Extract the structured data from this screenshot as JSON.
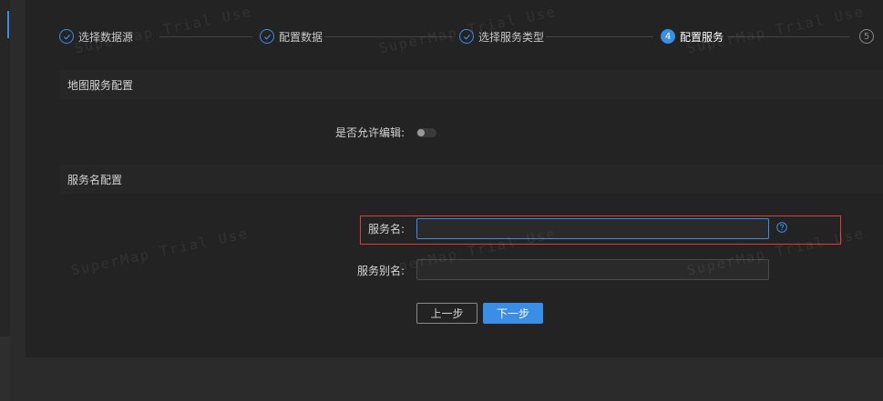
{
  "watermark_text": "SuperMap Trial Use",
  "steps": [
    {
      "index": "1",
      "label": "选择数据源",
      "state": "done"
    },
    {
      "index": "2",
      "label": "配置数据",
      "state": "done"
    },
    {
      "index": "3",
      "label": "选择服务类型",
      "state": "done"
    },
    {
      "index": "4",
      "label": "配置服务",
      "state": "active"
    },
    {
      "index": "5",
      "label": "",
      "state": "pending"
    }
  ],
  "map_service_section": {
    "title": "地图服务配置",
    "allow_edit_label": "是否允许编辑:",
    "allow_edit_value": false
  },
  "service_name_section": {
    "title": "服务名配置",
    "service_name_label": "服务名:",
    "service_name_value": "",
    "service_alias_label": "服务别名:",
    "service_alias_value": ""
  },
  "buttons": {
    "prev_label": "上一步",
    "next_label": "下一步"
  },
  "colors": {
    "accent": "#3a8ee6",
    "highlight": "#e03c3c",
    "background": "#232323"
  }
}
